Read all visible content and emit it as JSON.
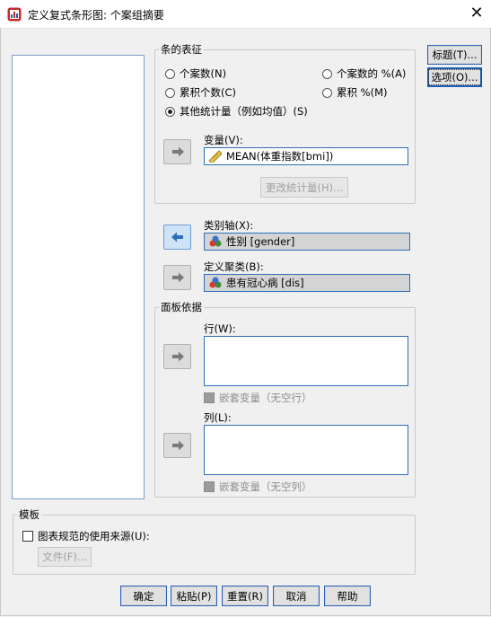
{
  "window": {
    "title": "定义复式条形图: 个案组摘要",
    "close_glyph": "✕"
  },
  "bars_group": {
    "legend": "条的表征",
    "options": [
      {
        "label": "个案数(N)",
        "selected": false
      },
      {
        "label": "个案数的 %(A)",
        "selected": false
      },
      {
        "label": "累积个数(C)",
        "selected": false
      },
      {
        "label": "累积 %(M)",
        "selected": false
      },
      {
        "label": "其他统计量（例如均值）(S)",
        "selected": true
      }
    ],
    "variable_label": "变量(V):",
    "variable_value": "MEAN(体重指数[bmi])",
    "change_stat_button": "更改统计量(H)..."
  },
  "category_axis": {
    "label": "类别轴(X):",
    "value": "性别 [gender]"
  },
  "define_clusters": {
    "label": "定义聚类(B):",
    "value": "患有冠心病 [dis]"
  },
  "panels": {
    "legend": "面板依据",
    "rows_label": "行(W):",
    "nest_rows": "嵌套变量（无空行）",
    "cols_label": "列(L):",
    "nest_cols": "嵌套变量（无空列）"
  },
  "template": {
    "legend": "模板",
    "use_chart_spec": "图表规范的使用来源(U):",
    "file_button": "文件(F)..."
  },
  "side_buttons": {
    "titles": "标题(T)...",
    "options": "选项(O)..."
  },
  "bottom_buttons": [
    "确定",
    "粘贴(P)",
    "重置(R)",
    "取消",
    "帮助"
  ],
  "colors": {
    "accent_border": "#2d6fb8",
    "field_filled": "#d4d4d4"
  }
}
